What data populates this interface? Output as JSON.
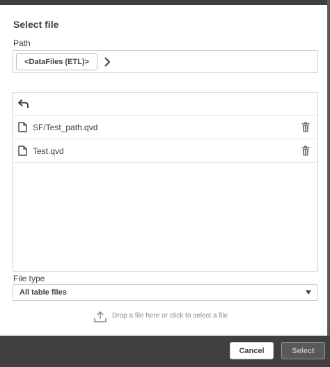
{
  "dialog": {
    "title": "Select file"
  },
  "path": {
    "label": "Path",
    "crumb": "<DataFiles (ETL)>",
    "chevron_icon": "chevron-right-icon"
  },
  "file_list": {
    "back_icon": "back-arrow-icon",
    "files": [
      {
        "name": "SF/Test_path.qvd",
        "icon": "document-icon",
        "action_icon": "trash-icon"
      },
      {
        "name": "Test.qvd",
        "icon": "document-icon",
        "action_icon": "trash-icon"
      }
    ]
  },
  "file_type": {
    "label": "File type",
    "selected": "All table files"
  },
  "drop_zone": {
    "icon": "upload-icon",
    "text": "Drop a file here or click to select a file"
  },
  "footer": {
    "cancel_label": "Cancel",
    "select_label": "Select",
    "select_enabled": false
  },
  "colors": {
    "chrome_dark": "#404040",
    "border": "#cfcfcf",
    "text": "#404040",
    "muted_text": "#8c8c8c"
  }
}
